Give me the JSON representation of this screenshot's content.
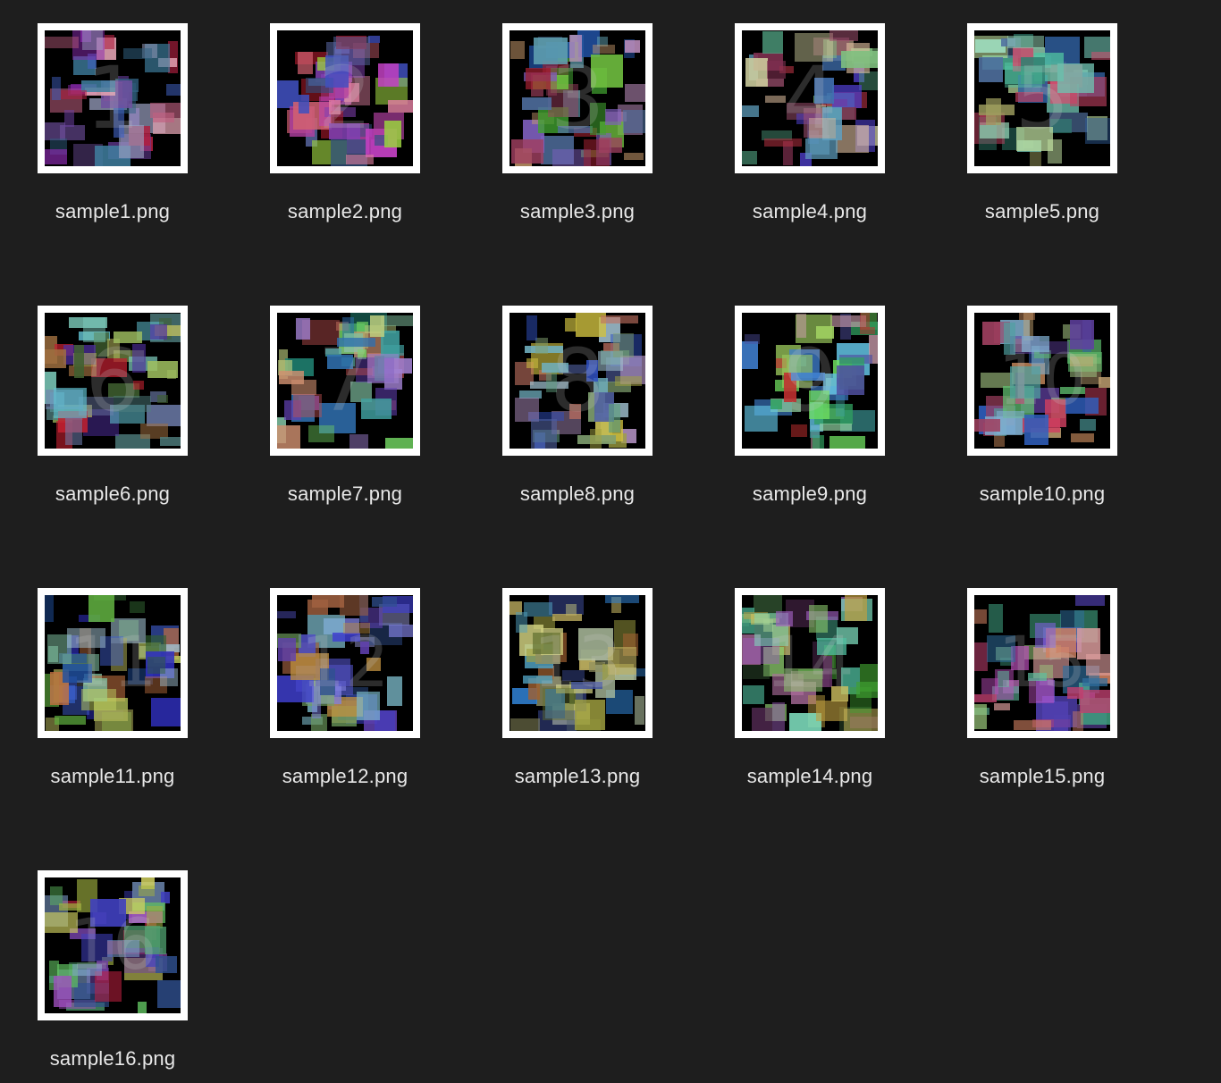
{
  "files": [
    {
      "name": "sample1.png",
      "digit": "1",
      "palette": [
        "#8a2bb0",
        "#6b3fa0",
        "#c06080",
        "#3f7fa0",
        "#b02040",
        "#9aa0c0",
        "#4060c0",
        "#7050a0",
        "#e0a0b0",
        "#306080"
      ]
    },
    {
      "name": "sample2.png",
      "digit": "2",
      "palette": [
        "#c040c0",
        "#8040b0",
        "#a01828",
        "#4050c0",
        "#e080a0",
        "#6070b0",
        "#b040a0",
        "#9bd040",
        "#305080",
        "#d06070"
      ]
    },
    {
      "name": "sample3.png",
      "digit": "3",
      "palette": [
        "#40a030",
        "#a04060",
        "#5070a0",
        "#c090c0",
        "#8060c0",
        "#d0a070",
        "#2050a0",
        "#60a0b0",
        "#a02030",
        "#70c040"
      ]
    },
    {
      "name": "sample4.png",
      "digit": "4",
      "palette": [
        "#5040d0",
        "#50a080",
        "#a05070",
        "#60a0c0",
        "#e0c0a0",
        "#80c080",
        "#b03040",
        "#4070b0",
        "#d0d0a0",
        "#803050"
      ]
    },
    {
      "name": "sample5.png",
      "digit": "5",
      "palette": [
        "#50c0a0",
        "#a0e0c0",
        "#c04060",
        "#308070",
        "#c0e0a0",
        "#5070a0",
        "#a0a060",
        "#3060a0",
        "#d05070",
        "#70c0b0"
      ]
    },
    {
      "name": "sample6.png",
      "digit": "6",
      "palette": [
        "#60c0d0",
        "#a0c060",
        "#508080",
        "#c02030",
        "#7080b0",
        "#406030",
        "#a07040",
        "#80d0c0",
        "#5030a0",
        "#c0c060"
      ]
    },
    {
      "name": "sample7.png",
      "digit": "7",
      "palette": [
        "#70d060",
        "#40a0a0",
        "#c05050",
        "#a080d0",
        "#d09070",
        "#3070b0",
        "#80c0a0",
        "#6040b0",
        "#c0d080",
        "#208070"
      ]
    },
    {
      "name": "sample8.png",
      "digit": "8",
      "palette": [
        "#a0c0d0",
        "#d0c040",
        "#5060a0",
        "#80a070",
        "#c07060",
        "#3050c0",
        "#60a080",
        "#b090c0",
        "#a0a040",
        "#70b0c0"
      ]
    },
    {
      "name": "sample9.png",
      "digit": "9",
      "palette": [
        "#70e060",
        "#4080d0",
        "#30a060",
        "#c03030",
        "#a0d060",
        "#5050a0",
        "#60c0e0",
        "#d0a0b0",
        "#40a0a0",
        "#90d0a0"
      ]
    },
    {
      "name": "sample10.png",
      "digit": "10",
      "palette": [
        "#d09060",
        "#60c070",
        "#3060c0",
        "#a04060",
        "#80b0d0",
        "#c0a070",
        "#6040a0",
        "#a0c080",
        "#d04060",
        "#50a0a0"
      ]
    },
    {
      "name": "sample11.png",
      "digit": "11",
      "palette": [
        "#3030c0",
        "#60b040",
        "#80c0a0",
        "#c07040",
        "#a0c0d0",
        "#2050a0",
        "#a0a050",
        "#4060d0",
        "#c0d060",
        "#306030"
      ]
    },
    {
      "name": "sample12.png",
      "digit": "12",
      "palette": [
        "#4040d0",
        "#8080e0",
        "#80c0d0",
        "#c09040",
        "#6040b0",
        "#305090",
        "#a0a0e0",
        "#a06040",
        "#70a060",
        "#5050c0"
      ]
    },
    {
      "name": "sample13.png",
      "digit": "13",
      "palette": [
        "#3080d0",
        "#a0a040",
        "#d0d080",
        "#607030",
        "#c0b060",
        "#4050a0",
        "#909060",
        "#a06030",
        "#50a0c0",
        "#b0c0a0"
      ]
    },
    {
      "name": "sample14.png",
      "digit": "14",
      "palette": [
        "#50c0a0",
        "#c0a040",
        "#40a030",
        "#a060c0",
        "#603060",
        "#d0c060",
        "#80e0c0",
        "#b070a0",
        "#305030",
        "#90d070"
      ]
    },
    {
      "name": "sample15.png",
      "digit": "15",
      "palette": [
        "#c050c0",
        "#40a080",
        "#8060e0",
        "#d08060",
        "#60c0a0",
        "#c04070",
        "#a0d080",
        "#5040b0",
        "#e0a0a0",
        "#3070a0"
      ]
    },
    {
      "name": "sample16.png",
      "digit": "16",
      "palette": [
        "#a0b040",
        "#4040c0",
        "#60c060",
        "#c02040",
        "#80a0d0",
        "#a050c0",
        "#305090",
        "#d0d060",
        "#50a070",
        "#7040a0"
      ]
    }
  ]
}
